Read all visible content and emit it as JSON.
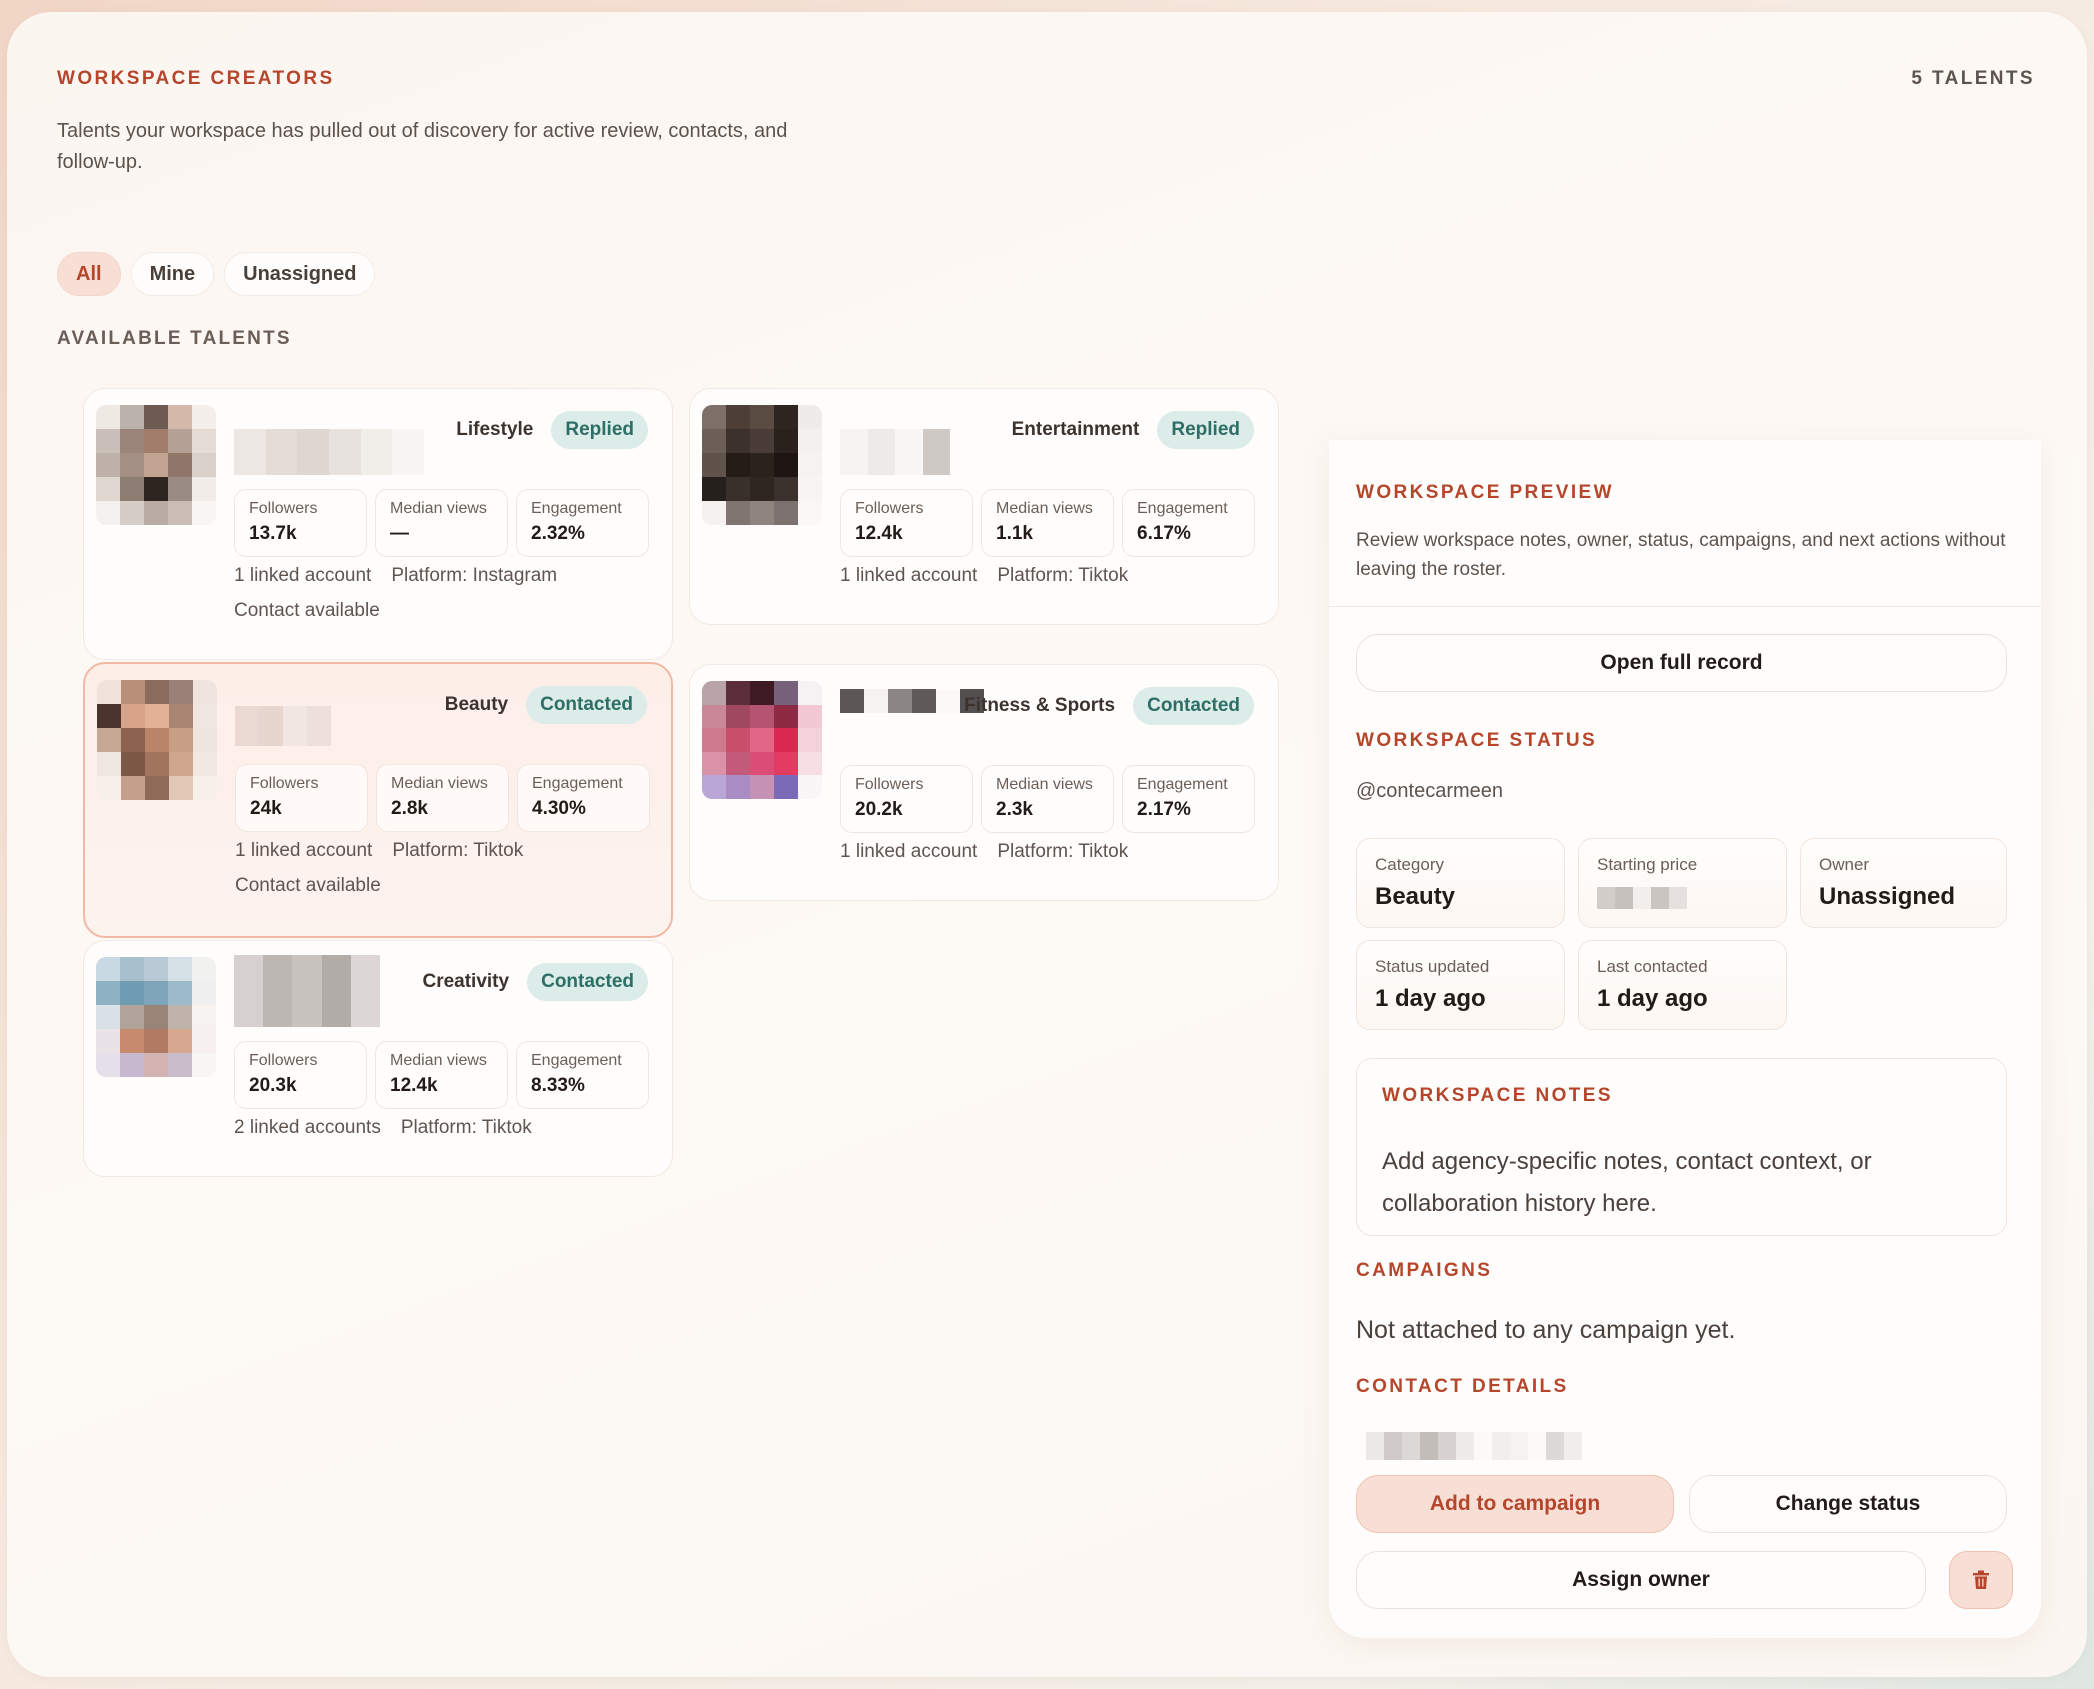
{
  "header": {
    "title": "WORKSPACE CREATORS",
    "count": "5 TALENTS",
    "description": "Talents your workspace has pulled out of discovery for active review, contacts, and follow-up."
  },
  "filters": [
    "All",
    "Mine",
    "Unassigned"
  ],
  "active_filter": "All",
  "section_label": "AVAILABLE TALENTS",
  "stat_labels": {
    "followers": "Followers",
    "median_views": "Median views",
    "engagement": "Engagement"
  },
  "talents": [
    {
      "category": "Lifestyle",
      "status": "Replied",
      "followers": "13.7k",
      "median_views": "—",
      "engagement": "2.32%",
      "linked": "1 linked account",
      "platform": "Platform: Instagram",
      "contact": "Contact available",
      "selected": false
    },
    {
      "category": "Entertainment",
      "status": "Replied",
      "followers": "12.4k",
      "median_views": "1.1k",
      "engagement": "6.17%",
      "linked": "1 linked account",
      "platform": "Platform: Tiktok",
      "contact": "",
      "selected": false
    },
    {
      "category": "Beauty",
      "status": "Contacted",
      "followers": "24k",
      "median_views": "2.8k",
      "engagement": "4.30%",
      "linked": "1 linked account",
      "platform": "Platform: Tiktok",
      "contact": "Contact available",
      "selected": true
    },
    {
      "category": "Fitness & Sports",
      "status": "Contacted",
      "followers": "20.2k",
      "median_views": "2.3k",
      "engagement": "2.17%",
      "linked": "1 linked account",
      "platform": "Platform: Tiktok",
      "contact": "",
      "selected": false
    },
    {
      "category": "Creativity",
      "status": "Contacted",
      "followers": "20.3k",
      "median_views": "12.4k",
      "engagement": "8.33%",
      "linked": "2 linked accounts",
      "platform": "Platform: Tiktok",
      "contact": "",
      "selected": false
    }
  ],
  "preview": {
    "title": "WORKSPACE PREVIEW",
    "description": "Review workspace notes, owner, status, campaigns, and next actions without leaving the roster.",
    "open_record": "Open full record",
    "status_title": "WORKSPACE STATUS",
    "handle": "@contecarmeen",
    "category_label": "Category",
    "category_value": "Beauty",
    "price_label": "Starting price",
    "owner_label": "Owner",
    "owner_value": "Unassigned",
    "status_updated_label": "Status updated",
    "status_updated_value": "1 day ago",
    "last_contacted_label": "Last contacted",
    "last_contacted_value": "1 day ago",
    "notes_title": "WORKSPACE NOTES",
    "notes_placeholder": "Add agency-specific notes, contact context, or collaboration history here.",
    "campaigns_title": "CAMPAIGNS",
    "campaigns_text": "Not attached to any campaign yet.",
    "contact_title": "CONTACT DETAILS",
    "add_campaign": "Add to campaign",
    "change_status": "Change status",
    "assign_owner": "Assign owner"
  },
  "colors": {
    "accent": "#b5462c",
    "badge_bg": "#dcece8",
    "badge_text": "#2d6e66",
    "primary_btn_bg": "#f8dfd5"
  },
  "icons": {
    "delete": "trash-icon"
  }
}
